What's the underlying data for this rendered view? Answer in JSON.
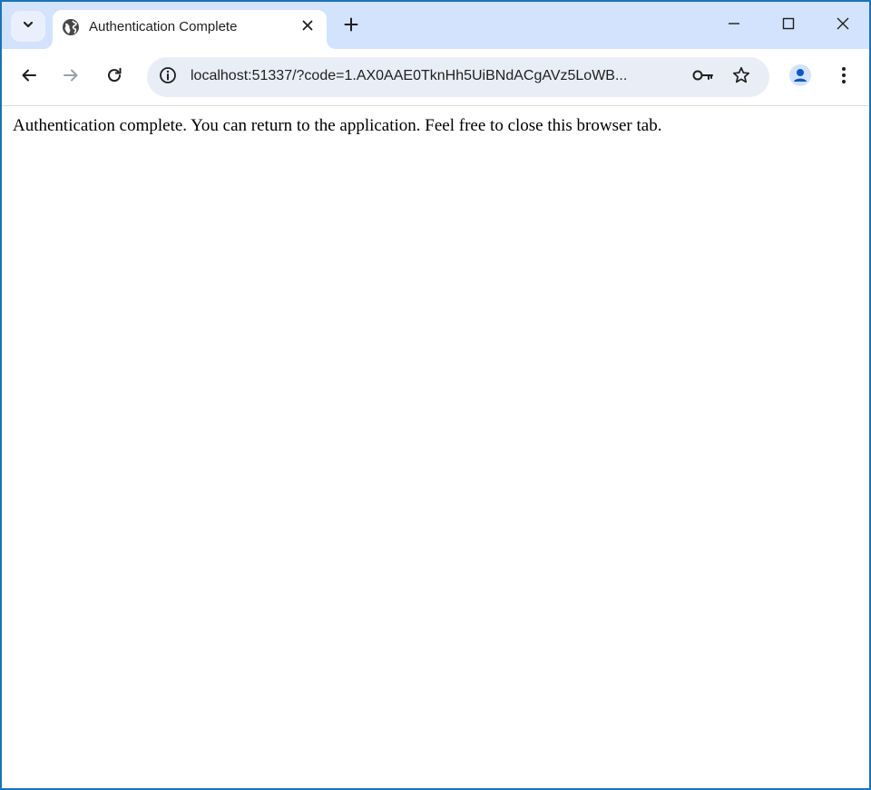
{
  "browser": {
    "tab": {
      "title": "Authentication Complete",
      "favicon": "globe-icon"
    },
    "tab_search_icon": "chevron-down-icon",
    "new_tab_icon": "plus-icon",
    "window_controls": [
      "minimize-icon",
      "maximize-icon",
      "close-icon"
    ],
    "toolbar": {
      "back_icon": "arrow-left-icon",
      "forward_icon": "arrow-right-icon",
      "reload_icon": "reload-icon",
      "site_info_icon": "info-icon",
      "url": "localhost:51337/?code=1.AX0AAE0TknHh5UiBNdACgAVz5LoWB...",
      "password_icon": "key-icon",
      "bookmark_icon": "star-icon",
      "profile_icon": "person-icon",
      "menu_icon": "more-vert-icon"
    }
  },
  "page": {
    "message": "Authentication complete. You can return to the application. Feel free to close this browser tab."
  },
  "colors": {
    "window_border": "#1a73b8",
    "tabstrip_bg": "#d3e3fd",
    "omnibox_bg": "#e9eef6",
    "profile_accent": "#0b57d0",
    "icon_color": "#474747"
  }
}
